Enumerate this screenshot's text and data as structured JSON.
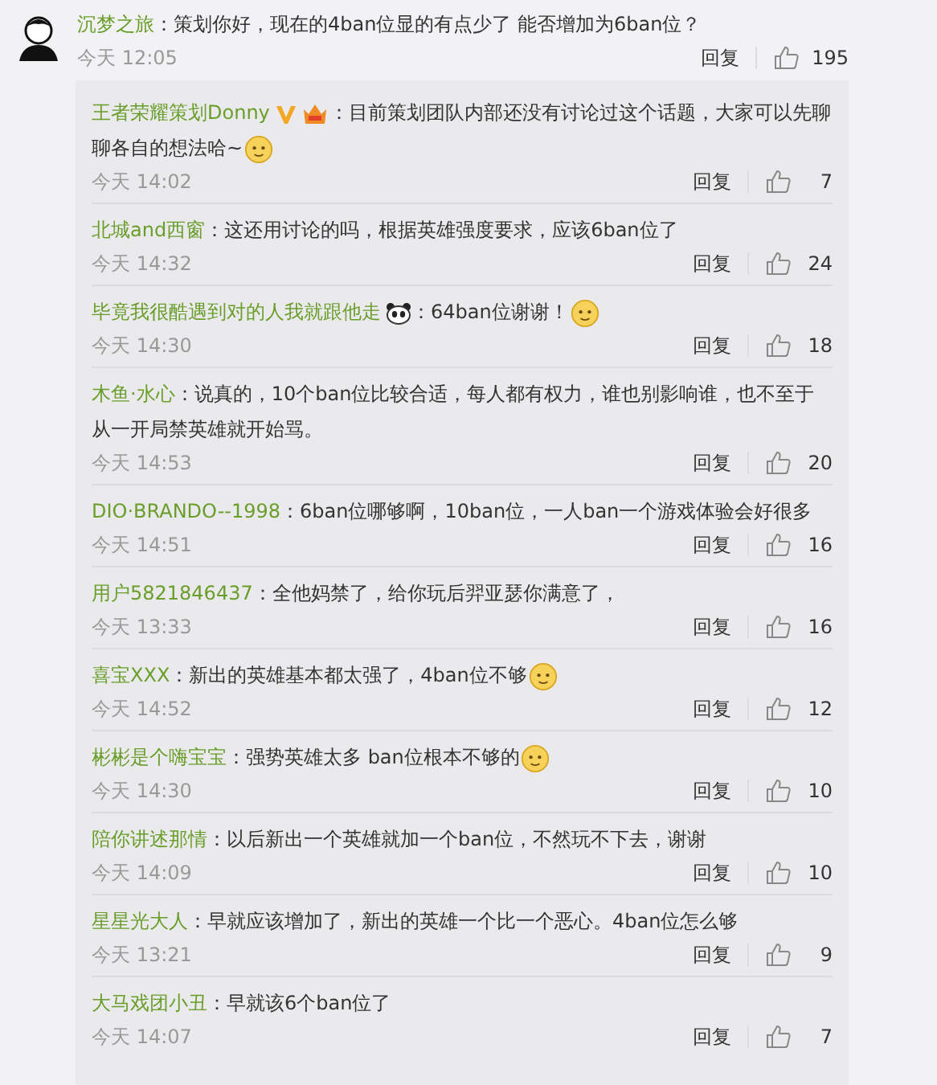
{
  "comment": {
    "user": "沉梦之旅",
    "text": "：策划你好，现在的4ban位显的有点少了  能否增加为6ban位？",
    "time": "今天 12:05",
    "reply_label": "回复",
    "likes": "195"
  },
  "replies": [
    {
      "user": "王者荣耀策划Donny",
      "badges": [
        {
          "kind": "verified"
        },
        {
          "kind": "crown"
        }
      ],
      "text": "：目前策划团队内部还没有讨论过这个话题，大家可以先聊聊各自的想法哈~",
      "trailing_emoji": true,
      "time": "今天 14:02",
      "reply_label": "回复",
      "likes": "7"
    },
    {
      "user": "北城and西窗",
      "text": "：这还用讨论的吗，根据英雄强度要求，应该6ban位了",
      "trailing_emoji": false,
      "time": "今天 14:32",
      "reply_label": "回复",
      "likes": "24"
    },
    {
      "user": "毕竟我很酷遇到对的人我就跟他走",
      "badges": [
        {
          "kind": "panda"
        }
      ],
      "text": "：64ban位谢谢！",
      "trailing_emoji": true,
      "time": "今天 14:30",
      "reply_label": "回复",
      "likes": "18"
    },
    {
      "user": "木鱼·水心",
      "text": "：说真的，10个ban位比较合适，每人都有权力，谁也别影响谁，也不至于从一开局禁英雄就开始骂。",
      "trailing_emoji": false,
      "time": "今天 14:53",
      "reply_label": "回复",
      "likes": "20"
    },
    {
      "user": "DIO·BRANDO--1998",
      "text": "：6ban位哪够啊，10ban位，一人ban一个游戏体验会好很多",
      "trailing_emoji": false,
      "time": "今天 14:51",
      "reply_label": "回复",
      "likes": "16"
    },
    {
      "user": "用户5821846437",
      "text": "：全他妈禁了，给你玩后羿亚瑟你满意了，",
      "trailing_emoji": false,
      "time": "今天 13:33",
      "reply_label": "回复",
      "likes": "16"
    },
    {
      "user": "喜宝XXX",
      "text": "：新出的英雄基本都太强了，4ban位不够",
      "trailing_emoji": true,
      "time": "今天 14:52",
      "reply_label": "回复",
      "likes": "12"
    },
    {
      "user": "彬彬是个嗨宝宝",
      "text": "：强势英雄太多 ban位根本不够的",
      "trailing_emoji": true,
      "time": "今天 14:30",
      "reply_label": "回复",
      "likes": "10"
    },
    {
      "user": "陪你讲述那情",
      "text": "：以后新出一个英雄就加一个ban位，不然玩不下去，谢谢",
      "trailing_emoji": false,
      "time": "今天 14:09",
      "reply_label": "回复",
      "likes": "10"
    },
    {
      "user": "星星光大人",
      "text": "：早就应该增加了，新出的英雄一个比一个恶心。4ban位怎么够",
      "trailing_emoji": false,
      "time": "今天 13:21",
      "reply_label": "回复",
      "likes": "9"
    },
    {
      "user": "大马戏团小丑",
      "text": "：早就该6个ban位了",
      "trailing_emoji": false,
      "time": "今天 14:07",
      "reply_label": "回复",
      "likes": "7"
    }
  ]
}
